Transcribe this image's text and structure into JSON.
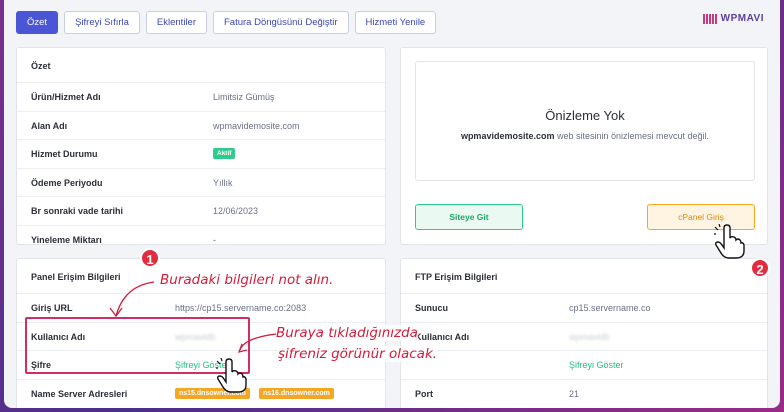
{
  "tabs": [
    "Özet",
    "Şifreyi Sıfırla",
    "Eklentiler",
    "Fatura Döngüsünü Değiştir",
    "Hizmeti Yenile"
  ],
  "logo": "WPMAVI",
  "summary": {
    "title": "Özet",
    "rows": [
      {
        "label": "Ürün/Hizmet Adı",
        "value": "Limitsiz Gümüş"
      },
      {
        "label": "Alan Adı",
        "value": "wpmavidemosite.com"
      },
      {
        "label": "Hizmet Durumu",
        "value": "Aktif"
      },
      {
        "label": "Ödeme Periyodu",
        "value": "Yıllık"
      },
      {
        "label": "Br sonraki vade tarihi",
        "value": "12/06/2023"
      },
      {
        "label": "Yineleme Miktarı",
        "value": "-"
      }
    ]
  },
  "preview": {
    "title": "Önizleme Yok",
    "site": "wpmavidemosite.com",
    "message": " web sitesinin önizlemesi mevcut değil.",
    "site_button": "Siteye Git",
    "cpanel_button": "cPanel Giriş"
  },
  "panel": {
    "title": "Panel Erişim Bilgileri",
    "login_url_label": "Giriş URL",
    "login_url": "https://cp15.servername.co:2083",
    "username_label": "Kullanıcı Adı",
    "username": "wpmavidb",
    "password_label": "Şifre",
    "password_link": "Şifreyi Göster",
    "ns_label": "Name Server Adresleri",
    "ns": [
      "ns15.dnsowner.com",
      "ns16.dnsowner.com"
    ]
  },
  "ftp": {
    "title": "FTP Erişim Bilgileri",
    "server_label": "Sunucu",
    "server": "cp15.servername.co",
    "user_label": "Kullanıcı Adı",
    "user": "wpmavidb",
    "password_link": "Şifreyi Göster",
    "port_label": "Port",
    "port": "21"
  },
  "annotations": {
    "badge1": "1",
    "badge2": "2",
    "note1": "Buradaki bilgileri not alın.",
    "note2_line1": "Buraya tıkladığınızda",
    "note2_line2": "şifreniz görünür olacak."
  },
  "colors": {
    "accent": "#4a56d6",
    "green": "#2ecc8b",
    "orange": "#f5a623",
    "annotation": "#d41c3b"
  }
}
